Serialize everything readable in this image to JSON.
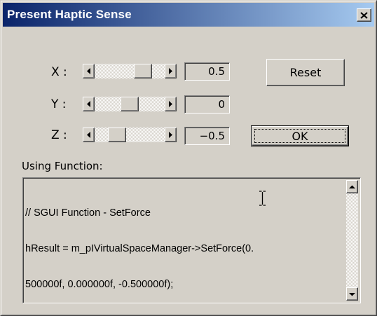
{
  "window": {
    "title": "Present Haptic Sense"
  },
  "sliders": [
    {
      "label": "X :",
      "value": "0.5",
      "position": 0.75
    },
    {
      "label": "Y :",
      "value": "0",
      "position": 0.5
    },
    {
      "label": "Z :",
      "value": "−0.5",
      "position": 0.25
    }
  ],
  "buttons": {
    "reset": "Reset",
    "ok": "OK"
  },
  "function_label": "Using Function:",
  "code_lines": [
    "// SGUI Function - SetForce",
    "hResult = m_pIVirtualSpaceManager->SetForce(0.",
    "500000f, 0.000000f, -0.500000f);"
  ],
  "icons": {
    "close": "close-x-icon",
    "left": "left-arrow-icon",
    "right": "right-arrow-icon",
    "up": "up-arrow-icon",
    "down": "down-arrow-icon",
    "cursor": "text-ibeam-cursor-icon"
  },
  "colors": {
    "title_bar_start": "#0a246a",
    "title_bar_end": "#a6caf0",
    "face": "#d4d0c8"
  }
}
